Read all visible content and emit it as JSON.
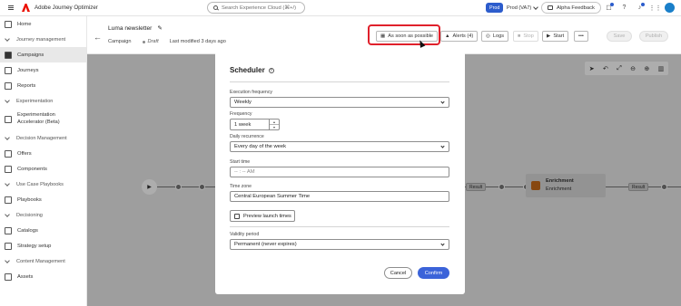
{
  "app": {
    "title": "Adobe Journey Optimizer"
  },
  "search": {
    "placeholder": "Search Experience Cloud (⌘+/)"
  },
  "env": {
    "badge": "Prod",
    "org": "Prod (VA7)"
  },
  "feedback": {
    "label": "Alpha Feedback"
  },
  "sidebar": {
    "home": "Home",
    "sec_journey": "Journey management",
    "campaigns": "Campaigns",
    "journeys": "Journeys",
    "reports": "Reports",
    "sec_experimentation": "Experimentation",
    "exp_accel_line1": "Experimentation",
    "exp_accel_line2": "Accelerator (Beta)",
    "sec_decision": "Decision Management",
    "offers": "Offers",
    "components": "Components",
    "sec_usecase": "Use Case Playbooks",
    "playbooks": "Playbooks",
    "sec_decisioning": "Decisioning",
    "catalogs": "Catalogs",
    "strategy": "Strategy setup",
    "sec_content": "Content Management",
    "assets": "Assets"
  },
  "header": {
    "title": "Luma newsletter",
    "type": "Campaign",
    "status": "Draft",
    "modified": "Last modified 3 days ago",
    "schedule_btn": "As soon as possible",
    "alerts_btn": "Alerts (4)",
    "logs_btn": "Logs",
    "stop_btn": "Stop",
    "start_btn": "Start",
    "more_btn": "•••",
    "save_btn": "Save",
    "publish_btn": "Publish"
  },
  "canvas": {
    "result1": "Result",
    "result2": "Result",
    "enrich_title": "Enrichment",
    "enrich_sub": "Enrichment"
  },
  "modal": {
    "title": "Scheduler",
    "help": "?",
    "exec_freq_label": "Execution frequency",
    "exec_freq_value": "Weekly",
    "frequency_label": "Frequency",
    "frequency_value": "1 week",
    "daily_label": "Daily recurrence",
    "daily_value": "Every day of the week",
    "start_label": "Start time",
    "start_placeholder": "-- : -- AM",
    "tz_label": "Time zone",
    "tz_value": "Central European Summer Time",
    "preview_btn": "Preview launch times",
    "validity_label": "Validity period",
    "validity_value": "Permanent (never expires)",
    "cancel": "Cancel",
    "confirm": "Confirm"
  },
  "colors": {
    "accent": "#3b63d9",
    "highlight": "#e0202b",
    "brand": "#eb1000"
  }
}
